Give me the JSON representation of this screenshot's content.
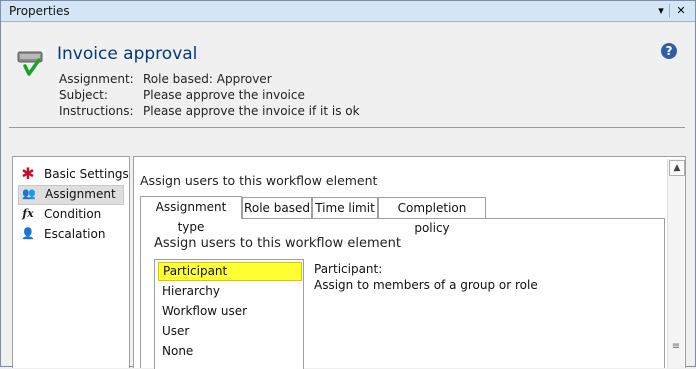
{
  "window": {
    "title": "Properties",
    "dropdown_glyph": "▾",
    "close_glyph": "✕"
  },
  "header": {
    "title": "Invoice approval",
    "help_glyph": "?",
    "fields": [
      {
        "label": "Assignment:",
        "value": "Role based: Approver"
      },
      {
        "label": "Subject:",
        "value": "Please approve the invoice"
      },
      {
        "label": "Instructions:",
        "value": "Please approve the invoice if it is ok"
      }
    ]
  },
  "nav": {
    "items": [
      {
        "label": "Basic Settings",
        "icon": "asterisk-icon",
        "glyph": "✱",
        "color": "#c8102e"
      },
      {
        "label": "Assignment",
        "icon": "users-icon",
        "glyph": "👥",
        "color": "#d07a00",
        "selected": true
      },
      {
        "label": "Condition",
        "icon": "function-icon",
        "glyph": "fx",
        "color": "#111111"
      },
      {
        "label": "Escalation",
        "icon": "escalation-icon",
        "glyph": "👤",
        "color": "#2a6fbf"
      }
    ]
  },
  "main": {
    "heading": "Assign users to this workflow element",
    "tabs": [
      {
        "label": "Assignment type",
        "active": true
      },
      {
        "label": "Role based"
      },
      {
        "label": "Time limit"
      },
      {
        "label": "Completion policy"
      }
    ],
    "inner_heading": "Assign users to this workflow element",
    "list": {
      "items": [
        "Participant",
        "Hierarchy",
        "Workflow user",
        "User",
        "None"
      ],
      "selected": "Participant"
    },
    "description": {
      "title": "Participant:",
      "text": "Assign to members of a group or role"
    }
  },
  "scrollbar": {
    "up_glyph": "▲",
    "grip_glyph": "≡"
  },
  "colors": {
    "selection_highlight": "#ffff33",
    "heading_blue": "#003b7a"
  }
}
